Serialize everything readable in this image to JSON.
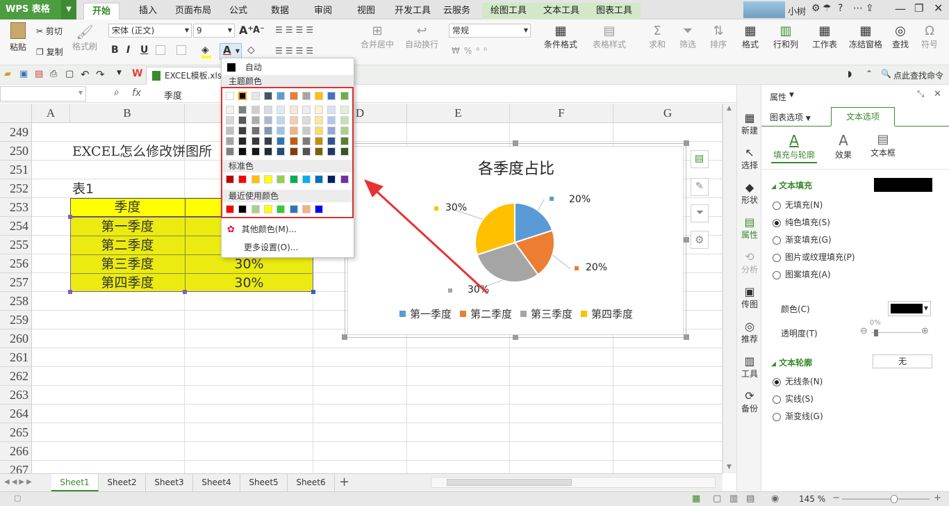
{
  "app": {
    "name": "WPS 表格",
    "username": "小树"
  },
  "tabs": [
    "开始",
    "插入",
    "页面布局",
    "公式",
    "数据",
    "审阅",
    "视图",
    "开发工具",
    "云服务",
    "绘图工具",
    "文本工具",
    "图表工具"
  ],
  "ribbon": {
    "paste": "粘贴",
    "cut": "剪切",
    "copy": "复制",
    "format_painter": "格式刷",
    "font_name": "宋体 (正文)",
    "font_size": "9",
    "bold": "B",
    "italic": "I",
    "underline": "U",
    "merge": "合并居中",
    "wrap": "自动换行",
    "number_format": "常规",
    "cond_format": "条件格式",
    "table_style": "表格样式",
    "sum": "求和",
    "filter": "筛选",
    "sort": "排序",
    "format": "格式",
    "rows_cols": "行和列",
    "worksheet": "工作表",
    "freeze": "冻结窗格",
    "find": "查找",
    "symbol": "符号"
  },
  "quickbar": {
    "doc_tab": "EXCEL模板.xls",
    "search": "点此查找命令"
  },
  "formula": {
    "content": "季度"
  },
  "columns": [
    "A",
    "B",
    "C",
    "D",
    "E",
    "F",
    "G"
  ],
  "rows": [
    "249",
    "250",
    "251",
    "252",
    "253",
    "254",
    "255",
    "256",
    "257",
    "258",
    "259",
    "260",
    "261",
    "262",
    "263",
    "264",
    "265",
    "266",
    "267"
  ],
  "cells": {
    "title": "EXCEL怎么修改饼图所",
    "table_label": "表1",
    "header": "季度",
    "r254": "第一季度",
    "r255": "第二季度",
    "r256": "第三季度",
    "r257": "第四季度",
    "v256": "30%",
    "v257": "30%"
  },
  "dropdown": {
    "auto": "自动",
    "theme_title": "主题颜色",
    "standard_title": "标准色",
    "recent_title": "最近使用颜色",
    "more_colors": "其他颜色(M)...",
    "more_settings": "更多设置(O)...",
    "theme_top": [
      "#ffffff",
      "#000000",
      "#e7e6e6",
      "#44546a",
      "#5b9bd5",
      "#ed7d31",
      "#a5a5a5",
      "#ffc000",
      "#4472c4",
      "#70ad47"
    ],
    "theme_rows": [
      [
        "#f2f2f2",
        "#7f7f7f",
        "#d0cece",
        "#d6dce4",
        "#deebf6",
        "#fbe5d5",
        "#ededed",
        "#fff2cc",
        "#dae3f3",
        "#e2efd9"
      ],
      [
        "#d8d8d8",
        "#595959",
        "#aeabab",
        "#adb9ca",
        "#bdd7ee",
        "#f7cbac",
        "#dbdbdb",
        "#fee599",
        "#b4c6e7",
        "#c5e0b3"
      ],
      [
        "#bfbfbf",
        "#3f3f3f",
        "#757070",
        "#8496b0",
        "#9cc3e5",
        "#f4b183",
        "#c9c9c9",
        "#ffd965",
        "#8eaadb",
        "#a8d08d"
      ],
      [
        "#a5a5a5",
        "#262626",
        "#3a3838",
        "#323f4f",
        "#2e75b5",
        "#c55a11",
        "#7b7b7b",
        "#bf9000",
        "#2f5496",
        "#538135"
      ],
      [
        "#7f7f7f",
        "#0c0c0c",
        "#171616",
        "#222a35",
        "#1e4e79",
        "#843c0b",
        "#525252",
        "#7f6000",
        "#1f3864",
        "#375623"
      ]
    ],
    "standard": [
      "#c00000",
      "#ff0000",
      "#ffc000",
      "#ffff00",
      "#92d050",
      "#00b050",
      "#00b0f0",
      "#0070c0",
      "#002060",
      "#7030a0"
    ],
    "recent": [
      "#ff0000",
      "#000000",
      "#a9d18e",
      "#ffff00",
      "#33cc33",
      "#2e75b6",
      "#f4b183",
      "#0000ff"
    ]
  },
  "chart_data": {
    "type": "pie",
    "title": "各季度占比",
    "categories": [
      "第一季度",
      "第二季度",
      "第三季度",
      "第四季度"
    ],
    "values": [
      20,
      20,
      30,
      30
    ],
    "labels": [
      "20%",
      "20%",
      "30%",
      "30%"
    ],
    "colors": [
      "#5b9bd5",
      "#ed7d31",
      "#a5a5a5",
      "#ffc000"
    ],
    "legend": "bottom"
  },
  "sheets": [
    "Sheet1",
    "Sheet2",
    "Sheet3",
    "Sheet4",
    "Sheet5",
    "Sheet6"
  ],
  "sidebar": [
    "新建",
    "选择",
    "形状",
    "属性",
    "分析",
    "传图",
    "推荐",
    "工具",
    "备份"
  ],
  "panel": {
    "title": "属性",
    "tab_chart": "图表选项",
    "tab_text": "文本选项",
    "sub_fill": "填充与轮廓",
    "sub_effect": "效果",
    "sub_textbox": "文本框",
    "text_fill": "文本填充",
    "fill_options": [
      "无填充(N)",
      "纯色填充(S)",
      "渐变填充(G)",
      "图片或纹理填充(P)",
      "图案填充(A)"
    ],
    "color_label": "颜色(C)",
    "transparency_label": "透明度(T)",
    "transparency_value": "0%",
    "text_outline": "文本轮廓",
    "outline_value": "无",
    "outline_options": [
      "无线条(N)",
      "实线(S)",
      "渐变线(G)"
    ]
  },
  "status": {
    "zoom": "145 %"
  }
}
